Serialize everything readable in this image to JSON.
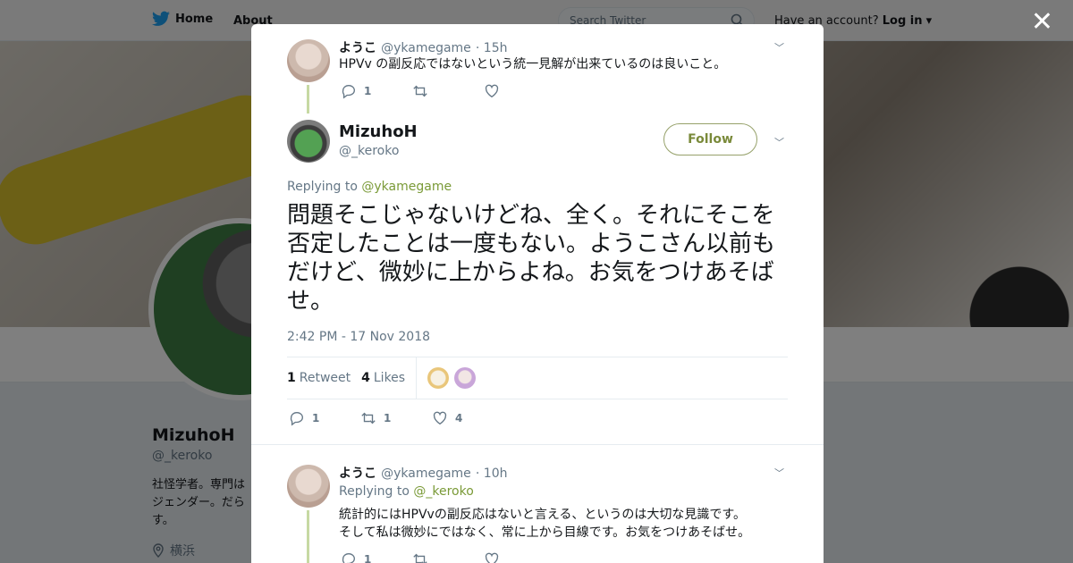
{
  "topnav": {
    "home_label": "Home",
    "about_label": "About",
    "search_placeholder": "Search Twitter",
    "have_account": "Have an account?",
    "login_label": "Log in"
  },
  "profile": {
    "name": "MizuhoH",
    "handle": "@_keroko",
    "bio": "社怪学者。専門は\nジェンダー。だら\nす。",
    "location": "横浜"
  },
  "modal": {
    "close_label": "✕",
    "parent_tweet": {
      "name": "ようこ",
      "handle": "@ykamegame",
      "time": "· 15h",
      "text": "HPVv の副反応ではないという統一見解が出来ているのは良いこと。",
      "reply_count": "1"
    },
    "main_tweet": {
      "name": "MizuhoH",
      "handle": "@_keroko",
      "follow_label": "Follow",
      "replying_prefix": "Replying to",
      "replying_to": "@ykamegame",
      "text": "問題そこじゃないけどね、全く。それにそこを否定したことは一度もない。ようこさん以前もだけど、微妙に上からよね。お気をつけあそばせ。",
      "timestamp": "2:42 PM - 17 Nov 2018",
      "retweets_count": "1",
      "retweets_label": "Retweet",
      "likes_count": "4",
      "likes_label": "Likes",
      "action_reply": "1",
      "action_retweet": "1",
      "action_like": "4"
    },
    "reply_tweet": {
      "name": "ようこ",
      "handle": "@ykamegame",
      "time": "· 10h",
      "replying_prefix": "Replying to",
      "replying_to": "@_keroko",
      "line1": "統計的にはHPVvの副反応はないと言える、というのは大切な見識です。",
      "line2": "そして私は微妙にではなく、常に上から目線です。お気をつけあそばせ。",
      "reply_count": "1"
    }
  },
  "colors": {
    "accent": "#7a9a37",
    "text": "#14171a",
    "muted": "#657786"
  }
}
